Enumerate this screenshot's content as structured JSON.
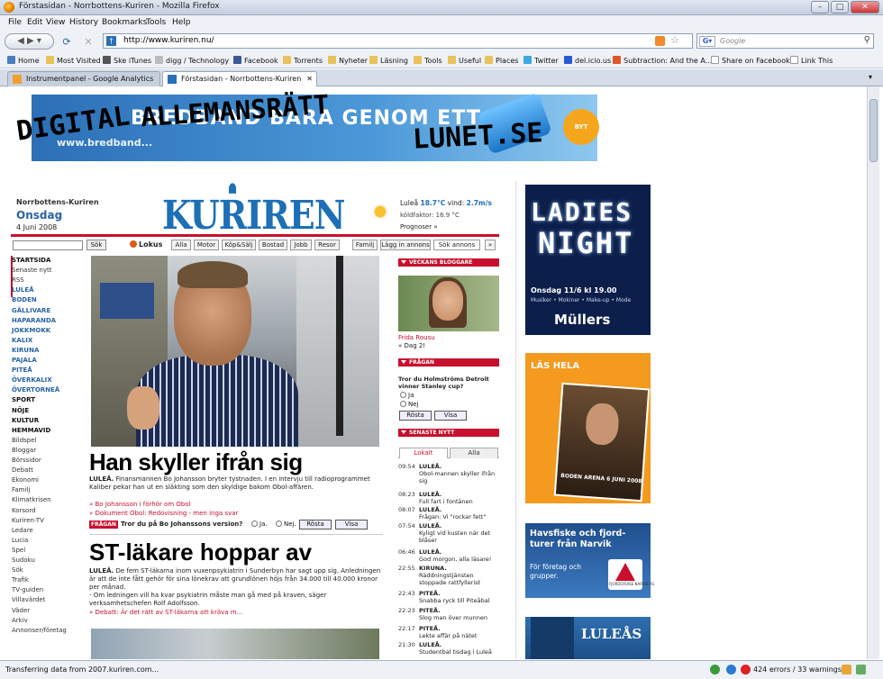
{
  "window": {
    "title": "Förstasidan - Norrbottens-Kuriren - Mozilla Firefox",
    "minimize": "–",
    "maximize": "□",
    "close": "✕"
  },
  "menu": [
    "File",
    "Edit",
    "View",
    "History",
    "Bookmarks",
    "Tools",
    "Help"
  ],
  "nav": {
    "url": "http://www.kuriren.nu/",
    "search_placeholder": "Google"
  },
  "bookmarks": [
    "Home",
    "Most Visited",
    "Ske iTunes",
    "digg / Technology",
    "Facebook",
    "Torrents",
    "Nyheter",
    "Läsning",
    "Tools",
    "Useful",
    "Places",
    "Twitter",
    "del.icio.us",
    "Subtraction: And the A...",
    "Share on Facebook",
    "Link This"
  ],
  "tabs": [
    {
      "label": "Instrumentpanel - Google Analytics"
    },
    {
      "label": "Förstasidan - Norrbottens-Kuriren",
      "close": "✕"
    }
  ],
  "banner": {
    "big": "BREDBAND BARA GENOM ETT",
    "url": "www.bredband...",
    "badge": "BYT",
    "graffiti1": "DIGITAL",
    "graffiti2": "ALLEMANSRÄTT",
    "graffiti3": "LUNET.SE"
  },
  "site": {
    "name": "Norrbottens-Kuriren",
    "day": "Onsdag",
    "date": "4 Juni 2008",
    "logo": "KURIREN"
  },
  "weather": {
    "place": "Luleå",
    "temp": "18.7°C",
    "wind_label": "vind:",
    "wind": "2.7m/s",
    "feel": "köldfaktor: 16.9 °C",
    "forecast": "Prognoser »"
  },
  "searchrow": {
    "button": "Sök",
    "lokus": "Lokus",
    "tabs": [
      "Alla",
      "Motor",
      "Köp&Sälj",
      "Bostad",
      "Jobb",
      "Resor",
      "Familj",
      "Lägg in annons",
      "Sök annons",
      "»"
    ]
  },
  "leftnav": {
    "items": [
      {
        "label": "STARTSIDA",
        "style": "black"
      },
      {
        "label": "Senaste nytt",
        "style": "plain"
      },
      {
        "label": "RSS",
        "style": "plain"
      },
      {
        "label": "LULEÅ",
        "style": "blue"
      },
      {
        "label": "BODEN",
        "style": "blue"
      },
      {
        "label": "GÄLLIVARE",
        "style": "blue"
      },
      {
        "label": "HAPARANDA",
        "style": "blue"
      },
      {
        "label": "JOKKMOKK",
        "style": "blue"
      },
      {
        "label": "KALIX",
        "style": "blue"
      },
      {
        "label": "KIRUNA",
        "style": "blue"
      },
      {
        "label": "PAJALA",
        "style": "blue"
      },
      {
        "label": "PITEÅ",
        "style": "blue"
      },
      {
        "label": "ÖVERKALIX",
        "style": "blue"
      },
      {
        "label": "ÖVERTORNEÅ",
        "style": "blue"
      },
      {
        "label": "SPORT",
        "style": "black"
      },
      {
        "label": "NÖJE",
        "style": "black"
      },
      {
        "label": "KULTUR",
        "style": "black"
      },
      {
        "label": "HEMMAVID",
        "style": "black"
      },
      {
        "label": "Bildspel",
        "style": "plain"
      },
      {
        "label": "Bloggar",
        "style": "plain"
      },
      {
        "label": "Börssidor",
        "style": "plain"
      },
      {
        "label": "Debatt",
        "style": "plain"
      },
      {
        "label": "Ekonomi",
        "style": "plain"
      },
      {
        "label": "Familj",
        "style": "plain"
      },
      {
        "label": "Klimatkrisen",
        "style": "plain"
      },
      {
        "label": "Korsord",
        "style": "plain"
      },
      {
        "label": "Kuriren-TV",
        "style": "plain"
      },
      {
        "label": "Ledare",
        "style": "plain"
      },
      {
        "label": "Lucia",
        "style": "plain"
      },
      {
        "label": "Spel",
        "style": "plain"
      },
      {
        "label": "Sudoku",
        "style": "plain"
      },
      {
        "label": "Sök",
        "style": "plain"
      },
      {
        "label": "Trafik",
        "style": "plain"
      },
      {
        "label": "TV-guiden",
        "style": "plain"
      },
      {
        "label": "Villavärdet",
        "style": "plain"
      },
      {
        "label": "Väder",
        "style": "plain"
      },
      {
        "label": "Arkiv",
        "style": "plain"
      },
      {
        "label": "Annonser/företag",
        "style": "plain"
      }
    ]
  },
  "article1": {
    "headline": "Han skyller ifrån sig",
    "dateline": "LULEÅ.",
    "body": " Finansmannen Bo Johansson bryter tystnaden.  I en intervju till radioprogrammet Kaliber pekar han ut en släkting som den skyldige bakom Obol-affären.",
    "link1": "» Bo Johansson i förhör om Obol",
    "link2": "» Dokument Obol: Redovisning - men inga svar",
    "poll_tag": "FRÅGAN",
    "poll_q": "Tror du på Bo Johanssons version?",
    "yes": "Ja.",
    "no": "Nej.",
    "vote": "Rösta",
    "show": "Visa"
  },
  "article2": {
    "headline": "ST-läkare hoppar av",
    "dateline": "LULEÅ.",
    "body": " De fem ST-läkarna inom vuxenpsykiatrin i Sunderbyn har sagt upp sig. Anledningen är att de inte fått gehör för sina lönekrav att grundlönen höjs från 34.000 till 40.000 kronor per månad.",
    "body2": "- Om ledningen vill ha kvar psykiatrin måste man gå med på kraven, säger verksamhetschefen Rolf Adolfsson.",
    "link": "» Debatt: Är det rätt av ST-läkarna att kräva m..."
  },
  "col3": {
    "blogger_head": "VECKANS BLOGGARE",
    "blogger_name": "Frida Rousu",
    "blogger_post": "» Dag 2!",
    "question_head": "FRÅGAN",
    "question": "Tror du Holmströms Detroit vinner Stanley cup?",
    "ja": "Ja",
    "nej": "Nej",
    "vote": "Rösta",
    "show": "Visa",
    "latest_head": "SENASTE NYTT",
    "tab_local": "Lokalt",
    "tab_all": "Alla",
    "news": [
      {
        "time": "09:54",
        "place": "LULEÅ.",
        "text": "Obol-mannen skyller ifrån sig"
      },
      {
        "time": "08:23",
        "place": "LULEÅ.",
        "text": "Full fart i fontänen"
      },
      {
        "time": "08:07",
        "place": "LULEÅ.",
        "text": "Frågan: Vi \"rockar fett\""
      },
      {
        "time": "07:54",
        "place": "LULEÅ.",
        "text": "Kyligt vid kusten när det blåser"
      },
      {
        "time": "06:46",
        "place": "LULEÅ.",
        "text": "God morgon, alla läsare!"
      },
      {
        "time": "22:55",
        "place": "KIRUNA.",
        "text": "Räddningstjänsten stoppade rattfyllerist"
      },
      {
        "time": "22:43",
        "place": "PITEÅ.",
        "text": "Snabba ryck till Piteåbal"
      },
      {
        "time": "22:23",
        "place": "PITEÅ.",
        "text": "Slog man över munnen"
      },
      {
        "time": "22:17",
        "place": "PITEÅ.",
        "text": "Lekte affär på nätet"
      },
      {
        "time": "21:30",
        "place": "LULEÅ.",
        "text": "Studentbal tisdag i Luleå"
      }
    ]
  },
  "ads": {
    "ad1_l1": "LADIES",
    "ad1_l2": "NIGHT",
    "ad1_l3": "Onsdag 11/6 kl 19.00",
    "ad1_l4": "Musiker • Mokiner • Make-up • Mode",
    "ad1_l5": "Müllers",
    "ad2_title": "LÄS HELA",
    "ad2_mag": "BODEN ARENA 6 JUNI 2008",
    "ad3_t1": "Havsfiske och fjord-turer från Narvik",
    "ad3_t2": "För företag och grupper.",
    "ad3_logo": "FJORDCRUISE NARVIK AS",
    "ad4_t": "LULEÅS"
  },
  "status": {
    "text": "Transferring data from 2007.kuriren.com...",
    "errors": "424 errors / 33 warnings"
  }
}
